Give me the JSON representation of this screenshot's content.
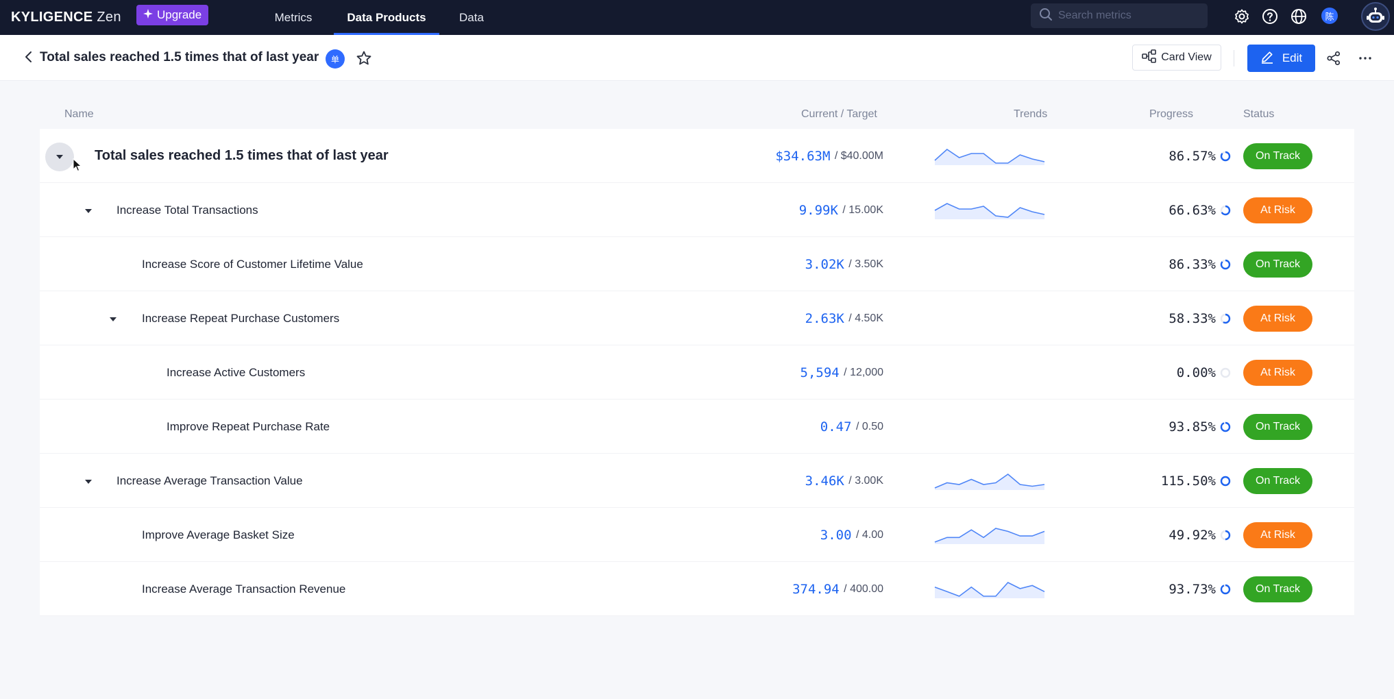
{
  "nav": {
    "brand": "KYLIGENCE",
    "brand_sub": "Zen",
    "upgrade_label": "Upgrade",
    "tabs": [
      {
        "label": "Metrics",
        "active": false
      },
      {
        "label": "Data Products",
        "active": true
      },
      {
        "label": "Data",
        "active": false
      }
    ],
    "search_placeholder": "Search metrics",
    "avatar_text": "陈",
    "icons": [
      "settings-icon",
      "help-icon",
      "globe-icon",
      "assistant-bot-icon"
    ]
  },
  "header": {
    "title": "Total sales reached 1.5 times that of last year",
    "badge_text": "单",
    "card_view_label": "Card View",
    "edit_label": "Edit"
  },
  "columns": {
    "name": "Name",
    "current_target": "Current / Target",
    "trends": "Trends",
    "progress": "Progress",
    "status": "Status"
  },
  "colors": {
    "on_track": "#33a524",
    "at_risk": "#fa7a17",
    "accent": "#1d63f0",
    "nav_bg": "#141a2e"
  },
  "rows": [
    {
      "name": "Total sales reached 1.5 times that of last year",
      "level": 0,
      "expandable": true,
      "current": "$34.63M",
      "target": "/ $40.00M",
      "progress": "86.57%",
      "progress_value": 0.8657,
      "status": "On Track",
      "trend": [
        3,
        11,
        5,
        8,
        8,
        1,
        1,
        7,
        4,
        2
      ]
    },
    {
      "name": "Increase Total Transactions",
      "level": 1,
      "expandable": true,
      "current": "9.99K",
      "target": "/ 15.00K",
      "progress": "66.63%",
      "progress_value": 0.6663,
      "status": "At Risk",
      "trend": [
        6,
        11,
        7,
        7,
        9,
        2,
        1,
        8,
        5,
        3
      ]
    },
    {
      "name": "Increase Score of Customer Lifetime Value",
      "level": 2,
      "expandable": false,
      "current": "3.02K",
      "target": "/ 3.50K",
      "progress": "86.33%",
      "progress_value": 0.8633,
      "status": "On Track",
      "trend": []
    },
    {
      "name": "Increase Repeat Purchase Customers",
      "level": 2,
      "expandable": true,
      "current": "2.63K",
      "target": "/ 4.50K",
      "progress": "58.33%",
      "progress_value": 0.5833,
      "status": "At Risk",
      "trend": []
    },
    {
      "name": "Increase Active Customers",
      "level": 3,
      "expandable": false,
      "current": "5,594",
      "target": "/ 12,000",
      "progress": "0.00%",
      "progress_value": 0,
      "status": "At Risk",
      "trend": []
    },
    {
      "name": "Improve Repeat Purchase Rate",
      "level": 3,
      "expandable": false,
      "current": "0.47",
      "target": "/ 0.50",
      "progress": "93.85%",
      "progress_value": 0.9385,
      "status": "On Track",
      "trend": []
    },
    {
      "name": "Increase Average Transaction Value",
      "level": 1,
      "expandable": true,
      "current": "3.46K",
      "target": "/ 3.00K",
      "progress": "115.50%",
      "progress_value": 1,
      "status": "On Track",
      "trend": [
        1,
        4,
        3,
        6,
        3,
        4,
        9,
        3,
        2,
        3
      ]
    },
    {
      "name": "Improve Average Basket Size",
      "level": 2,
      "expandable": false,
      "current": "3.00",
      "target": "/ 4.00",
      "progress": "49.92%",
      "progress_value": 0.4992,
      "status": "At Risk",
      "trend": [
        1,
        4,
        4,
        9,
        4,
        10,
        8,
        5,
        5,
        8
      ]
    },
    {
      "name": "Increase Average Transaction Revenue",
      "level": 2,
      "expandable": false,
      "current": "374.94",
      "target": "/ 400.00",
      "progress": "93.73%",
      "progress_value": 0.9373,
      "status": "On Track",
      "trend": [
        7,
        4,
        1,
        7,
        1,
        1,
        10,
        6,
        8,
        4
      ]
    }
  ]
}
